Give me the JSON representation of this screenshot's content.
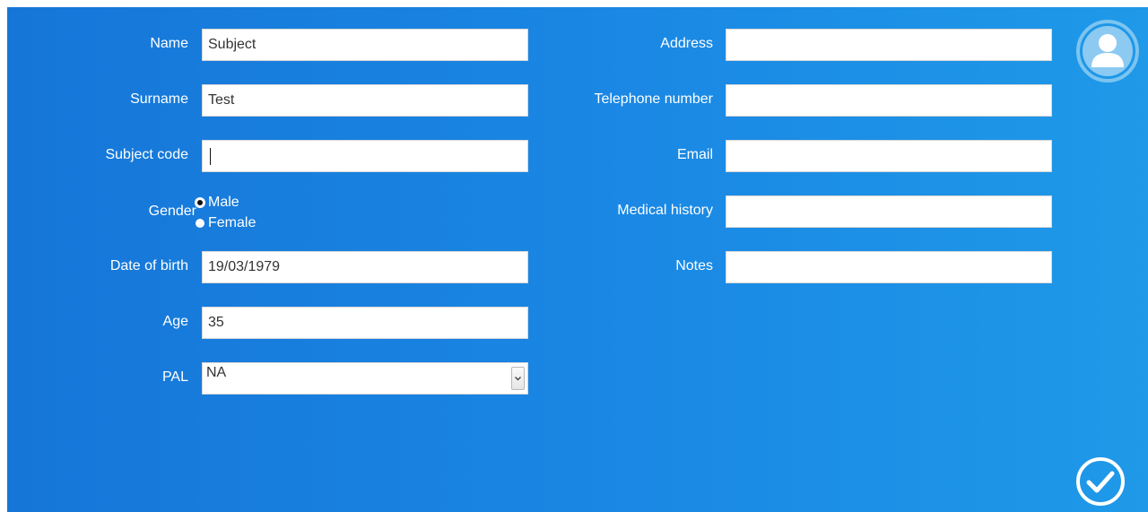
{
  "form": {
    "name": {
      "label": "Name",
      "value": "Subject"
    },
    "surname": {
      "label": "Surname",
      "value": "Test"
    },
    "subject_code": {
      "label": "Subject code",
      "value": ""
    },
    "gender": {
      "label": "Gender",
      "options": [
        "Male",
        "Female"
      ],
      "selected": "Male"
    },
    "date_of_birth": {
      "label": "Date of birth",
      "value": "19/03/1979"
    },
    "age": {
      "label": "Age",
      "value": "35"
    },
    "pal": {
      "label": "PAL",
      "value": "NA"
    },
    "address": {
      "label": "Address",
      "value": ""
    },
    "telephone": {
      "label": "Telephone number",
      "value": ""
    },
    "email": {
      "label": "Email",
      "value": ""
    },
    "medical_history": {
      "label": "Medical history",
      "value": ""
    },
    "notes": {
      "label": "Notes",
      "value": ""
    }
  },
  "icons": {
    "profile": "user-avatar-icon",
    "confirm": "checkmark-icon"
  },
  "colors": {
    "background_left": "#1676d8",
    "background_right": "#1f99e8",
    "label_text": "#ffffff",
    "field_background": "#ffffff"
  }
}
